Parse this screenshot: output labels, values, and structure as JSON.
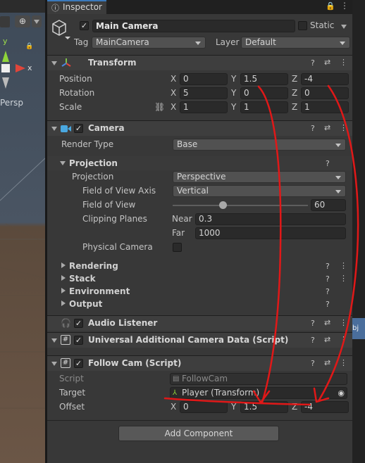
{
  "scene": {
    "axis_y": "y",
    "axis_x": "x",
    "persp": "Persp"
  },
  "tab": {
    "label": "Inspector"
  },
  "gameobject": {
    "name": "Main Camera",
    "static_label": "Static",
    "tag_label": "Tag",
    "tag": "MainCamera",
    "layer_label": "Layer",
    "layer": "Default"
  },
  "transform": {
    "title": "Transform",
    "position": {
      "label": "Position",
      "x": "0",
      "y": "1.5",
      "z": "-4"
    },
    "rotation": {
      "label": "Rotation",
      "x": "5",
      "y": "0",
      "z": "0"
    },
    "scale": {
      "label": "Scale",
      "x": "1",
      "y": "1",
      "z": "1"
    },
    "axis": {
      "x": "X",
      "y": "Y",
      "z": "Z"
    }
  },
  "camera": {
    "title": "Camera",
    "render_type_label": "Render Type",
    "render_type": "Base",
    "projection_section": "Projection",
    "projection_label": "Projection",
    "projection": "Perspective",
    "fov_axis_label": "Field of View Axis",
    "fov_axis": "Vertical",
    "fov_label": "Field of View",
    "fov": "60",
    "fov_fraction": 0.37,
    "clip_label": "Clipping Planes",
    "near_label": "Near",
    "near": "0.3",
    "far_label": "Far",
    "far": "1000",
    "physical_label": "Physical Camera",
    "sections": [
      "Rendering",
      "Stack",
      "Environment",
      "Output"
    ]
  },
  "audio": {
    "title": "Audio Listener"
  },
  "urp": {
    "title": "Universal Additional Camera Data (Script)"
  },
  "followcam": {
    "title": "Follow Cam (Script)",
    "script_label": "Script",
    "script": "FollowCam",
    "target_label": "Target",
    "target": "Player (Transform)",
    "offset_label": "Offset",
    "x": "0",
    "y": "1.5",
    "z": "-4"
  },
  "add_component": "Add Component",
  "colors": {
    "accent": "#3a79bb",
    "annotation": "#e01818"
  }
}
